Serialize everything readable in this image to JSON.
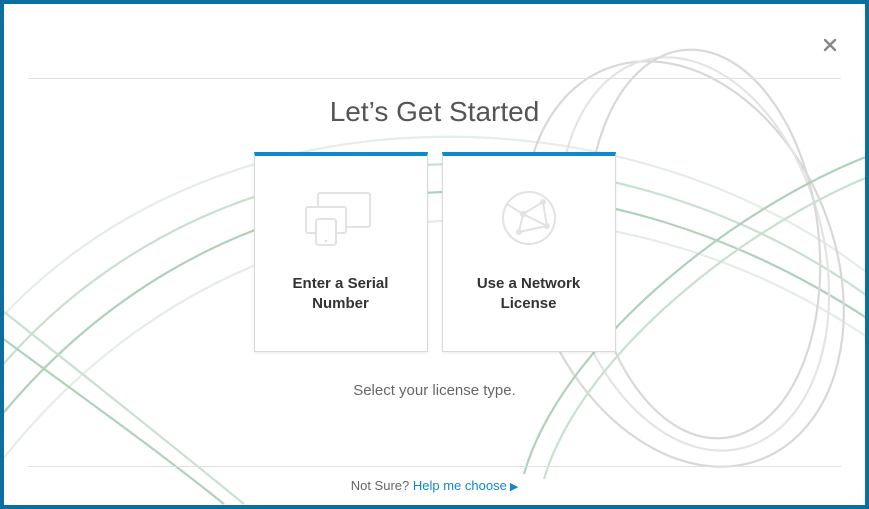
{
  "title": "Let’s Get Started",
  "cards": [
    {
      "label": "Enter a Serial\nNumber",
      "icon": "devices"
    },
    {
      "label": "Use a Network\nLicense",
      "icon": "network"
    }
  ],
  "subtext": "Select your license type.",
  "footer": {
    "prompt": "Not Sure? ",
    "link": "Help me choose"
  },
  "colors": {
    "frame": "#0a6ea1",
    "accent": "#1288c9"
  }
}
